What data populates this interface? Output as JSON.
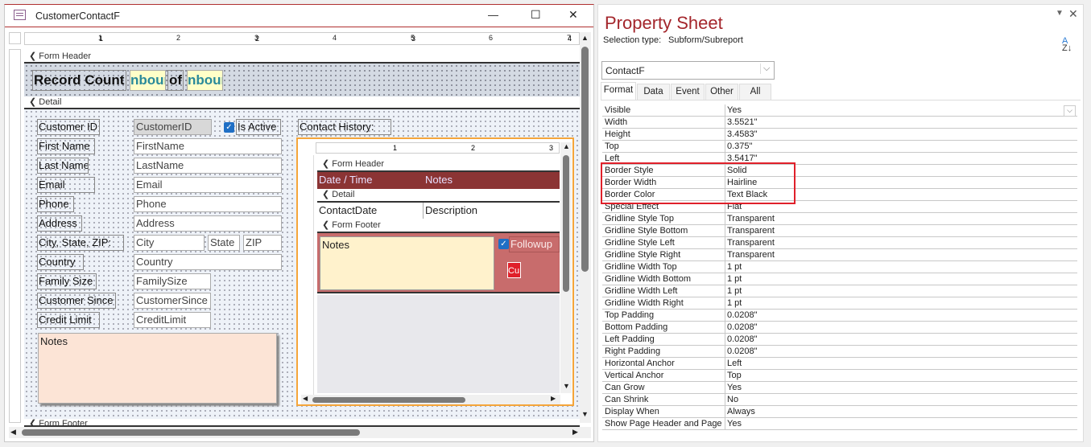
{
  "window": {
    "title": "CustomerContactF",
    "min": "—",
    "max": "☐",
    "close": "✕"
  },
  "ruler": [
    "1",
    "2",
    "3",
    "4",
    "5",
    "6",
    "7"
  ],
  "sections": {
    "form_header": "Form Header",
    "detail": "Detail",
    "form_footer": "Form Footer"
  },
  "header": {
    "record_count_label": "Record Count:",
    "count1": "nbour",
    "of_label": "of",
    "count2": "nbour"
  },
  "detail": {
    "customer_id_label": "Customer ID",
    "customer_id": "CustomerID",
    "is_active_label": "Is Active",
    "contact_history_label": "Contact History:",
    "rows": [
      {
        "label": "First Name",
        "field": "FirstName"
      },
      {
        "label": "Last Name",
        "field": "LastName"
      },
      {
        "label": "Email",
        "field": "Email"
      },
      {
        "label": "Phone",
        "field": "Phone"
      },
      {
        "label": "Address",
        "field": "Address"
      },
      {
        "label": "City, State, ZIP:",
        "field": "City"
      },
      {
        "label": "Country",
        "field": "Country"
      },
      {
        "label": "Family Size",
        "field": "FamilySize"
      },
      {
        "label": "Customer Since",
        "field": "CustomerSince"
      },
      {
        "label": "Credit Limit",
        "field": "CreditLimit"
      }
    ],
    "state": "State",
    "zip": "ZIP",
    "notes": "Notes"
  },
  "subform": {
    "ruler": [
      "1",
      "2",
      "3"
    ],
    "form_header": "Form Header",
    "detail": "Detail",
    "form_footer": "Form Footer",
    "col_date": "Date / Time",
    "col_notes": "Notes",
    "contact_date": "ContactDate",
    "description": "Description",
    "notes": "Notes",
    "followup": "Followup",
    "button": "Cu"
  },
  "property_sheet": {
    "title": "Property Sheet",
    "selection_type_label": "Selection type:",
    "selection_type": "Subform/Subreport",
    "sort_icon": "A\nZ↓",
    "object": "ContactF",
    "tabs": [
      "Format",
      "Data",
      "Event",
      "Other",
      "All"
    ],
    "active_tab": "Format",
    "properties": [
      [
        "Visible",
        "Yes"
      ],
      [
        "Width",
        "3.5521\""
      ],
      [
        "Height",
        "3.4583\""
      ],
      [
        "Top",
        "0.375\""
      ],
      [
        "Left",
        "3.5417\""
      ],
      [
        "Border Style",
        "Solid"
      ],
      [
        "Border Width",
        "Hairline"
      ],
      [
        "Border Color",
        "Text Black"
      ],
      [
        "Special Effect",
        "Flat"
      ],
      [
        "Gridline Style Top",
        "Transparent"
      ],
      [
        "Gridline Style Bottom",
        "Transparent"
      ],
      [
        "Gridline Style Left",
        "Transparent"
      ],
      [
        "Gridline Style Right",
        "Transparent"
      ],
      [
        "Gridline Width Top",
        "1 pt"
      ],
      [
        "Gridline Width Bottom",
        "1 pt"
      ],
      [
        "Gridline Width Left",
        "1 pt"
      ],
      [
        "Gridline Width Right",
        "1 pt"
      ],
      [
        "Top Padding",
        "0.0208\""
      ],
      [
        "Bottom Padding",
        "0.0208\""
      ],
      [
        "Left Padding",
        "0.0208\""
      ],
      [
        "Right Padding",
        "0.0208\""
      ],
      [
        "Horizontal Anchor",
        "Left"
      ],
      [
        "Vertical Anchor",
        "Top"
      ],
      [
        "Can Grow",
        "Yes"
      ],
      [
        "Can Shrink",
        "No"
      ],
      [
        "Display When",
        "Always"
      ],
      [
        "Show Page Header and Page",
        "Yes"
      ]
    ],
    "highlight_color": "#e0202a"
  }
}
